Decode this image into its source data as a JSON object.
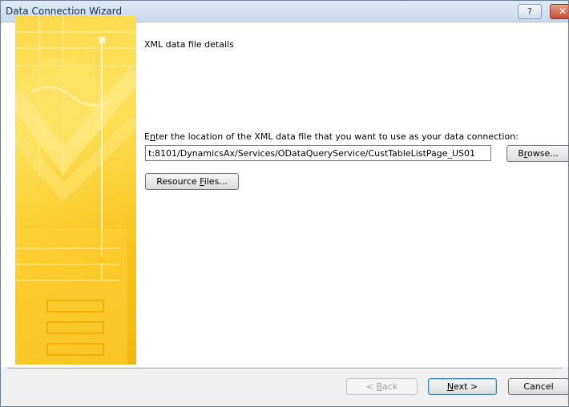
{
  "window": {
    "title": "Data Connection Wizard",
    "help_glyph": "?",
    "close_glyph": "✕"
  },
  "main": {
    "heading": "XML data file details",
    "prompt_pre": "E",
    "prompt_accel": "n",
    "prompt_post": "ter the location of the XML data file that you want to use as your data connection:",
    "path_value": "t:8101/DynamicsAx/Services/ODataQueryService/CustTableListPage_US01",
    "browse_pre": "B",
    "browse_accel": "r",
    "browse_post": "owse...",
    "resource_pre": "Resource ",
    "resource_accel": "F",
    "resource_post": "iles..."
  },
  "footer": {
    "back_pre": "< ",
    "back_accel": "B",
    "back_post": "ack",
    "next_accel": "N",
    "next_post": "ext >",
    "cancel_label": "Cancel"
  }
}
